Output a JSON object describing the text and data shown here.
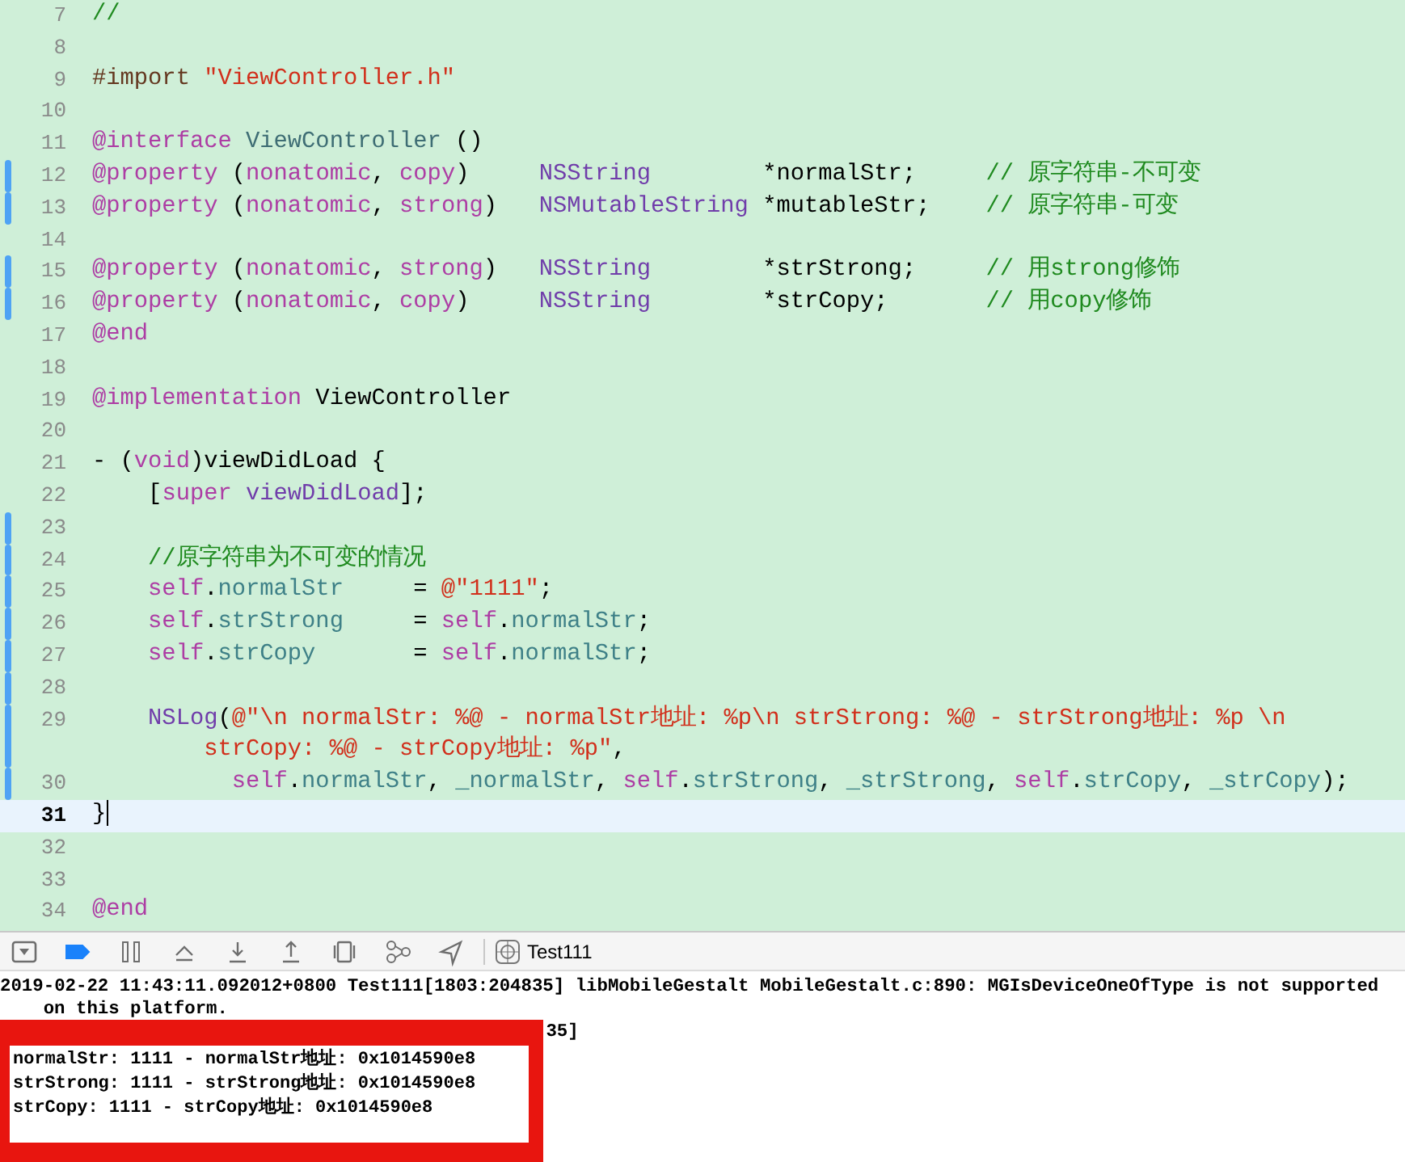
{
  "editor": {
    "lines": [
      {
        "number": "7",
        "changed": false,
        "current": false,
        "tokens": [
          {
            "kind": "comment",
            "text": "//"
          }
        ]
      },
      {
        "number": "8",
        "changed": false,
        "current": false
      },
      {
        "number": "9",
        "changed": false,
        "current": false,
        "tokens": [
          {
            "kind": "preprocessor",
            "text": "#import "
          },
          {
            "kind": "string",
            "text": "\"ViewController.h\""
          }
        ]
      },
      {
        "number": "10",
        "changed": false,
        "current": false
      },
      {
        "number": "11",
        "changed": false,
        "current": false,
        "tokens": [
          {
            "kind": "keyword",
            "text": "@interface "
          },
          {
            "kind": "class",
            "text": "ViewController"
          },
          {
            "kind": "plain",
            "text": " ()"
          }
        ]
      },
      {
        "number": "12",
        "changed": true,
        "current": false,
        "tokens": [
          {
            "kind": "keyword",
            "text": "@property"
          },
          {
            "kind": "plain",
            "text": " ("
          },
          {
            "kind": "keyword",
            "text": "nonatomic"
          },
          {
            "kind": "plain",
            "text": ", "
          },
          {
            "kind": "keyword",
            "text": "copy"
          },
          {
            "kind": "plain",
            "text": ")     "
          },
          {
            "kind": "type",
            "text": "NSString"
          },
          {
            "kind": "plain",
            "text": "        *normalStr;     "
          },
          {
            "kind": "comment",
            "text": "// 原字符串-不可变"
          }
        ]
      },
      {
        "number": "13",
        "changed": true,
        "current": false,
        "tokens": [
          {
            "kind": "keyword",
            "text": "@property"
          },
          {
            "kind": "plain",
            "text": " ("
          },
          {
            "kind": "keyword",
            "text": "nonatomic"
          },
          {
            "kind": "plain",
            "text": ", "
          },
          {
            "kind": "keyword",
            "text": "strong"
          },
          {
            "kind": "plain",
            "text": ")   "
          },
          {
            "kind": "type",
            "text": "NSMutableString"
          },
          {
            "kind": "plain",
            "text": " *mutableStr;    "
          },
          {
            "kind": "comment",
            "text": "// 原字符串-可变"
          }
        ]
      },
      {
        "number": "14",
        "changed": false,
        "current": false
      },
      {
        "number": "15",
        "changed": true,
        "current": false,
        "tokens": [
          {
            "kind": "keyword",
            "text": "@property"
          },
          {
            "kind": "plain",
            "text": " ("
          },
          {
            "kind": "keyword",
            "text": "nonatomic"
          },
          {
            "kind": "plain",
            "text": ", "
          },
          {
            "kind": "keyword",
            "text": "strong"
          },
          {
            "kind": "plain",
            "text": ")   "
          },
          {
            "kind": "type",
            "text": "NSString"
          },
          {
            "kind": "plain",
            "text": "        *strStrong;     "
          },
          {
            "kind": "comment",
            "text": "// 用strong修饰"
          }
        ]
      },
      {
        "number": "16",
        "changed": true,
        "current": false,
        "tokens": [
          {
            "kind": "keyword",
            "text": "@property"
          },
          {
            "kind": "plain",
            "text": " ("
          },
          {
            "kind": "keyword",
            "text": "nonatomic"
          },
          {
            "kind": "plain",
            "text": ", "
          },
          {
            "kind": "keyword",
            "text": "copy"
          },
          {
            "kind": "plain",
            "text": ")     "
          },
          {
            "kind": "type",
            "text": "NSString"
          },
          {
            "kind": "plain",
            "text": "        *strCopy;       "
          },
          {
            "kind": "comment",
            "text": "// 用copy修饰"
          }
        ]
      },
      {
        "number": "17",
        "changed": false,
        "current": false,
        "tokens": [
          {
            "kind": "keyword",
            "text": "@end"
          }
        ]
      },
      {
        "number": "18",
        "changed": false,
        "current": false
      },
      {
        "number": "19",
        "changed": false,
        "current": false,
        "tokens": [
          {
            "kind": "keyword",
            "text": "@implementation"
          },
          {
            "kind": "plain",
            "text": " ViewController"
          }
        ]
      },
      {
        "number": "20",
        "changed": false,
        "current": false
      },
      {
        "number": "21",
        "changed": false,
        "current": false,
        "tokens": [
          {
            "kind": "plain",
            "text": "- ("
          },
          {
            "kind": "keyword",
            "text": "void"
          },
          {
            "kind": "plain",
            "text": ")viewDidLoad {"
          }
        ]
      },
      {
        "number": "22",
        "changed": false,
        "current": false,
        "tokens": [
          {
            "kind": "plain",
            "text": "    ["
          },
          {
            "kind": "keyword",
            "text": "super "
          },
          {
            "kind": "function",
            "text": "viewDidLoad"
          },
          {
            "kind": "plain",
            "text": "];"
          }
        ]
      },
      {
        "number": "23",
        "changed": true,
        "current": false
      },
      {
        "number": "24",
        "changed": true,
        "current": false,
        "tokens": [
          {
            "kind": "comment",
            "text": "    //原字符串为不可变的情况"
          }
        ]
      },
      {
        "number": "25",
        "changed": true,
        "current": false,
        "tokens": [
          {
            "kind": "keyword",
            "text": "    self"
          },
          {
            "kind": "plain",
            "text": "."
          },
          {
            "kind": "property",
            "text": "normalStr"
          },
          {
            "kind": "plain",
            "text": "     = "
          },
          {
            "kind": "string",
            "text": "@\"1111\""
          },
          {
            "kind": "plain",
            "text": ";"
          }
        ]
      },
      {
        "number": "26",
        "changed": true,
        "current": false,
        "tokens": [
          {
            "kind": "keyword",
            "text": "    self"
          },
          {
            "kind": "plain",
            "text": "."
          },
          {
            "kind": "property",
            "text": "strStrong"
          },
          {
            "kind": "plain",
            "text": "     = "
          },
          {
            "kind": "keyword",
            "text": "self"
          },
          {
            "kind": "plain",
            "text": "."
          },
          {
            "kind": "property",
            "text": "normalStr"
          },
          {
            "kind": "plain",
            "text": ";"
          }
        ]
      },
      {
        "number": "27",
        "changed": true,
        "current": false,
        "tokens": [
          {
            "kind": "keyword",
            "text": "    self"
          },
          {
            "kind": "plain",
            "text": "."
          },
          {
            "kind": "property",
            "text": "strCopy"
          },
          {
            "kind": "plain",
            "text": "       = "
          },
          {
            "kind": "keyword",
            "text": "self"
          },
          {
            "kind": "plain",
            "text": "."
          },
          {
            "kind": "property",
            "text": "normalStr"
          },
          {
            "kind": "plain",
            "text": ";"
          }
        ]
      },
      {
        "number": "28",
        "changed": true,
        "current": false
      },
      {
        "number": "29",
        "changed": true,
        "current": false,
        "tokens": [
          {
            "kind": "function",
            "text": "    NSLog"
          },
          {
            "kind": "plain",
            "text": "("
          },
          {
            "kind": "string",
            "text": "@\"\\n normalStr: %@ - normalStr地址: %p\\n strStrong: %@ - strStrong地址: %p \\n strCopy: %@ - strCopy地址: %p\""
          },
          {
            "kind": "plain",
            "text": ","
          }
        ]
      },
      {
        "number": "30",
        "changed": true,
        "current": false,
        "tokens": [
          {
            "kind": "keyword",
            "text": "          self"
          },
          {
            "kind": "plain",
            "text": "."
          },
          {
            "kind": "property",
            "text": "normalStr"
          },
          {
            "kind": "plain",
            "text": ", "
          },
          {
            "kind": "property",
            "text": "_normalStr"
          },
          {
            "kind": "plain",
            "text": ", "
          },
          {
            "kind": "keyword",
            "text": "self"
          },
          {
            "kind": "plain",
            "text": "."
          },
          {
            "kind": "property",
            "text": "strStrong"
          },
          {
            "kind": "plain",
            "text": ", "
          },
          {
            "kind": "property",
            "text": "_strStrong"
          },
          {
            "kind": "plain",
            "text": ", "
          },
          {
            "kind": "keyword",
            "text": "self"
          },
          {
            "kind": "plain",
            "text": "."
          },
          {
            "kind": "property",
            "text": "strCopy"
          },
          {
            "kind": "plain",
            "text": ", "
          },
          {
            "kind": "property",
            "text": "_strCopy"
          },
          {
            "kind": "plain",
            "text": ");"
          }
        ]
      },
      {
        "number": "31",
        "changed": false,
        "current": true,
        "tokens": [
          {
            "kind": "plain",
            "text": "}"
          }
        ]
      },
      {
        "number": "32",
        "changed": false,
        "current": false
      },
      {
        "number": "33",
        "changed": false,
        "current": false
      },
      {
        "number": "34",
        "changed": false,
        "current": false,
        "tokens": [
          {
            "kind": "keyword",
            "text": "@end"
          }
        ]
      }
    ]
  },
  "debug_bar": {
    "icons": [
      {
        "kind": "console-toggle",
        "on": false
      },
      {
        "kind": "breakpoints",
        "on": true
      },
      {
        "kind": "pause",
        "on": false
      },
      {
        "kind": "step-over",
        "on": false
      },
      {
        "kind": "step-into",
        "on": false
      },
      {
        "kind": "step-out",
        "on": false
      },
      {
        "kind": "view-debugger",
        "on": false
      },
      {
        "kind": "memory-graph",
        "on": false
      },
      {
        "kind": "location",
        "on": false
      }
    ],
    "target": "Test111"
  },
  "console": {
    "lines": [
      {
        "kind": "full",
        "text": "2019-02-22 11:43:11.092012+0800 Test111[1803:204835] libMobileGestalt MobileGestalt.c:890: MGIsDeviceOneOfType is not supported on this platform."
      },
      {
        "kind": "partial",
        "text": "35]"
      }
    ],
    "highlight_box": {
      "lines": [
        "normalStr: 1111 - normalStr地址: 0x1014590e8",
        "strStrong: 1111 - strStrong地址: 0x1014590e8",
        "strCopy: 1111 - strCopy地址: 0x1014590e8"
      ]
    }
  }
}
